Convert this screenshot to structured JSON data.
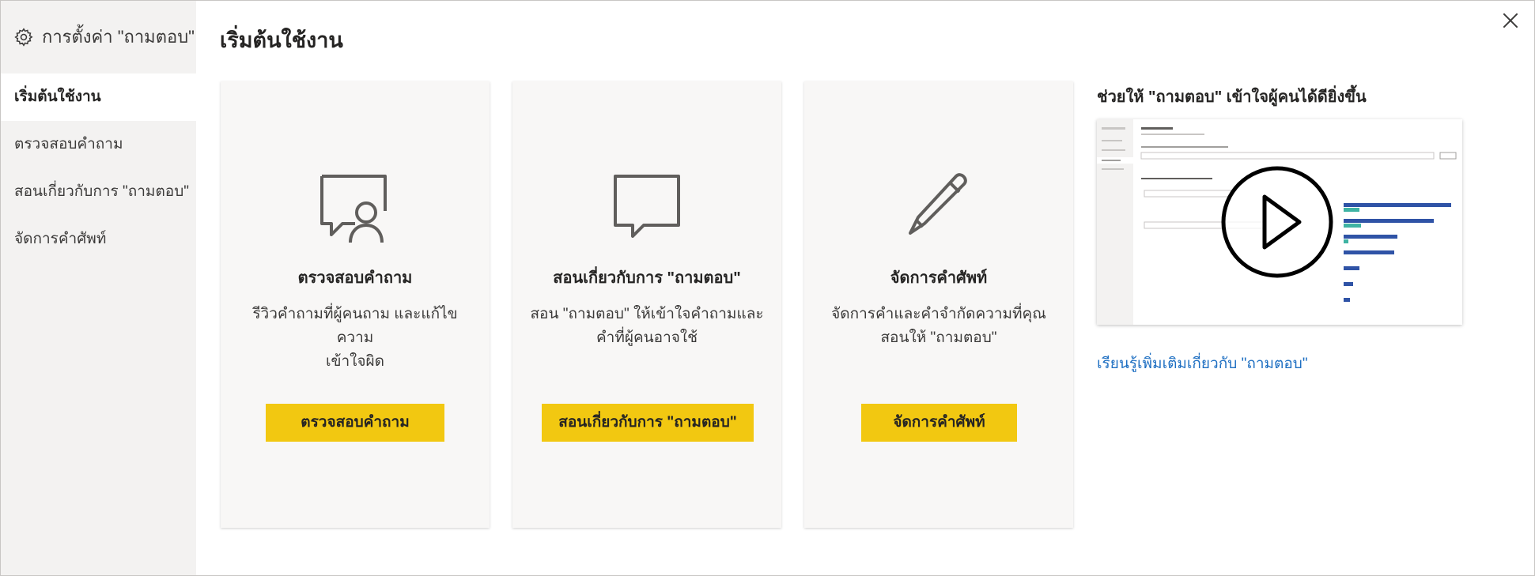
{
  "sidebar": {
    "header_label": "การตั้งค่า \"ถามตอบ\"",
    "items": [
      {
        "label": "เริ่มต้นใช้งาน",
        "active": true
      },
      {
        "label": "ตรวจสอบคำถาม",
        "active": false
      },
      {
        "label": "สอนเกี่ยวกับการ \"ถามตอบ\"",
        "active": false
      },
      {
        "label": "จัดการคำศัพท์",
        "active": false
      }
    ]
  },
  "main": {
    "title": "เริ่มต้นใช้งาน",
    "cards": [
      {
        "icon": "review-questions-icon",
        "title": "ตรวจสอบคำถาม",
        "desc_line1": "รีวิวคำถามที่ผู้คนถาม และแก้ไขความ",
        "desc_line2": "เข้าใจผิด",
        "button": "ตรวจสอบคำถาม"
      },
      {
        "icon": "speech-bubble-icon",
        "title": "สอนเกี่ยวกับการ \"ถามตอบ\"",
        "desc_line1": "สอน \"ถามตอบ\" ให้เข้าใจคำถามและ",
        "desc_line2": "คำที่ผู้คนอาจใช้",
        "button": "สอนเกี่ยวกับการ \"ถามตอบ\""
      },
      {
        "icon": "pencil-icon",
        "title": "จัดการคำศัพท์",
        "desc_line1": "จัดการคำและคำจำกัดความที่คุณ",
        "desc_line2": "สอนให้ \"ถามตอบ\"",
        "button": "จัดการคำศัพท์"
      }
    ],
    "help": {
      "title": "ช่วยให้ \"ถามตอบ\" เข้าใจผู้คนได้ดียิ่งขึ้น",
      "learn_more": "เรียนรู้เพิ่มเติมเกี่ยวกับ \"ถามตอบ\""
    }
  },
  "colors": {
    "accent": "#f2c811",
    "link": "#1e6fc2",
    "sidebar_bg": "#f3f2f1",
    "card_bg": "#f8f7f6"
  }
}
